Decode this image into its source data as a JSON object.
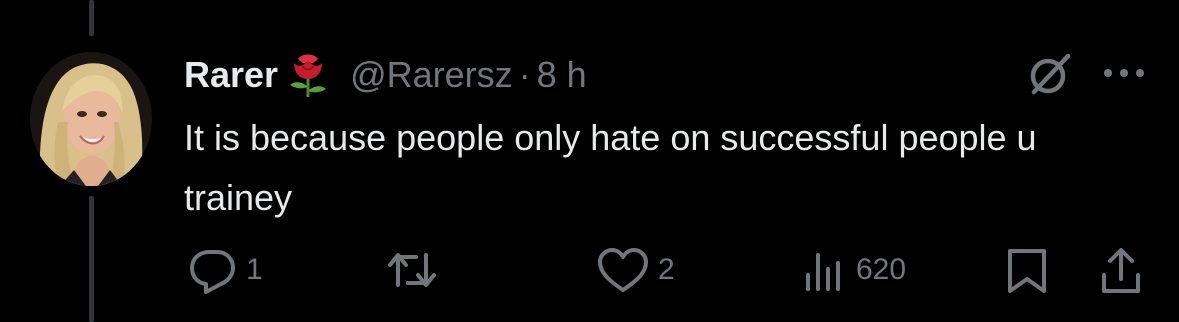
{
  "tweet": {
    "display_name": "Rarer",
    "emoji_icon": "rose-emoji",
    "handle": "@Rarersz",
    "separator": "·",
    "time": "8 h",
    "text": "It is because people only hate on successful people u trainey"
  },
  "actions": {
    "reply_count": "1",
    "repost_count": "",
    "like_count": "2",
    "views_count": "620"
  },
  "icons": {
    "reply": "reply-icon",
    "repost": "repost-icon",
    "like": "heart-icon",
    "views": "views-icon",
    "bookmark": "bookmark-icon",
    "share": "share-icon",
    "grok": "grok-icon",
    "more": "more-icon"
  },
  "colors": {
    "background": "#000000",
    "primary_text": "#e7e9ea",
    "secondary_text": "#71767b",
    "thread_line": "#333639"
  }
}
